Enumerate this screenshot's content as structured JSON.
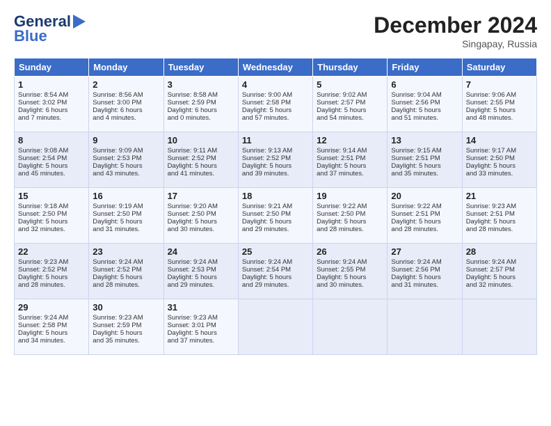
{
  "header": {
    "logo_line1": "General",
    "logo_line2": "Blue",
    "month": "December 2024",
    "location": "Singapay, Russia"
  },
  "days_of_week": [
    "Sunday",
    "Monday",
    "Tuesday",
    "Wednesday",
    "Thursday",
    "Friday",
    "Saturday"
  ],
  "weeks": [
    [
      {
        "day": 1,
        "lines": [
          "Sunrise: 8:54 AM",
          "Sunset: 3:02 PM",
          "Daylight: 6 hours",
          "and 7 minutes."
        ]
      },
      {
        "day": 2,
        "lines": [
          "Sunrise: 8:56 AM",
          "Sunset: 3:00 PM",
          "Daylight: 6 hours",
          "and 4 minutes."
        ]
      },
      {
        "day": 3,
        "lines": [
          "Sunrise: 8:58 AM",
          "Sunset: 2:59 PM",
          "Daylight: 6 hours",
          "and 0 minutes."
        ]
      },
      {
        "day": 4,
        "lines": [
          "Sunrise: 9:00 AM",
          "Sunset: 2:58 PM",
          "Daylight: 5 hours",
          "and 57 minutes."
        ]
      },
      {
        "day": 5,
        "lines": [
          "Sunrise: 9:02 AM",
          "Sunset: 2:57 PM",
          "Daylight: 5 hours",
          "and 54 minutes."
        ]
      },
      {
        "day": 6,
        "lines": [
          "Sunrise: 9:04 AM",
          "Sunset: 2:56 PM",
          "Daylight: 5 hours",
          "and 51 minutes."
        ]
      },
      {
        "day": 7,
        "lines": [
          "Sunrise: 9:06 AM",
          "Sunset: 2:55 PM",
          "Daylight: 5 hours",
          "and 48 minutes."
        ]
      }
    ],
    [
      {
        "day": 8,
        "lines": [
          "Sunrise: 9:08 AM",
          "Sunset: 2:54 PM",
          "Daylight: 5 hours",
          "and 45 minutes."
        ]
      },
      {
        "day": 9,
        "lines": [
          "Sunrise: 9:09 AM",
          "Sunset: 2:53 PM",
          "Daylight: 5 hours",
          "and 43 minutes."
        ]
      },
      {
        "day": 10,
        "lines": [
          "Sunrise: 9:11 AM",
          "Sunset: 2:52 PM",
          "Daylight: 5 hours",
          "and 41 minutes."
        ]
      },
      {
        "day": 11,
        "lines": [
          "Sunrise: 9:13 AM",
          "Sunset: 2:52 PM",
          "Daylight: 5 hours",
          "and 39 minutes."
        ]
      },
      {
        "day": 12,
        "lines": [
          "Sunrise: 9:14 AM",
          "Sunset: 2:51 PM",
          "Daylight: 5 hours",
          "and 37 minutes."
        ]
      },
      {
        "day": 13,
        "lines": [
          "Sunrise: 9:15 AM",
          "Sunset: 2:51 PM",
          "Daylight: 5 hours",
          "and 35 minutes."
        ]
      },
      {
        "day": 14,
        "lines": [
          "Sunrise: 9:17 AM",
          "Sunset: 2:50 PM",
          "Daylight: 5 hours",
          "and 33 minutes."
        ]
      }
    ],
    [
      {
        "day": 15,
        "lines": [
          "Sunrise: 9:18 AM",
          "Sunset: 2:50 PM",
          "Daylight: 5 hours",
          "and 32 minutes."
        ]
      },
      {
        "day": 16,
        "lines": [
          "Sunrise: 9:19 AM",
          "Sunset: 2:50 PM",
          "Daylight: 5 hours",
          "and 31 minutes."
        ]
      },
      {
        "day": 17,
        "lines": [
          "Sunrise: 9:20 AM",
          "Sunset: 2:50 PM",
          "Daylight: 5 hours",
          "and 30 minutes."
        ]
      },
      {
        "day": 18,
        "lines": [
          "Sunrise: 9:21 AM",
          "Sunset: 2:50 PM",
          "Daylight: 5 hours",
          "and 29 minutes."
        ]
      },
      {
        "day": 19,
        "lines": [
          "Sunrise: 9:22 AM",
          "Sunset: 2:50 PM",
          "Daylight: 5 hours",
          "and 28 minutes."
        ]
      },
      {
        "day": 20,
        "lines": [
          "Sunrise: 9:22 AM",
          "Sunset: 2:51 PM",
          "Daylight: 5 hours",
          "and 28 minutes."
        ]
      },
      {
        "day": 21,
        "lines": [
          "Sunrise: 9:23 AM",
          "Sunset: 2:51 PM",
          "Daylight: 5 hours",
          "and 28 minutes."
        ]
      }
    ],
    [
      {
        "day": 22,
        "lines": [
          "Sunrise: 9:23 AM",
          "Sunset: 2:52 PM",
          "Daylight: 5 hours",
          "and 28 minutes."
        ]
      },
      {
        "day": 23,
        "lines": [
          "Sunrise: 9:24 AM",
          "Sunset: 2:52 PM",
          "Daylight: 5 hours",
          "and 28 minutes."
        ]
      },
      {
        "day": 24,
        "lines": [
          "Sunrise: 9:24 AM",
          "Sunset: 2:53 PM",
          "Daylight: 5 hours",
          "and 29 minutes."
        ]
      },
      {
        "day": 25,
        "lines": [
          "Sunrise: 9:24 AM",
          "Sunset: 2:54 PM",
          "Daylight: 5 hours",
          "and 29 minutes."
        ]
      },
      {
        "day": 26,
        "lines": [
          "Sunrise: 9:24 AM",
          "Sunset: 2:55 PM",
          "Daylight: 5 hours",
          "and 30 minutes."
        ]
      },
      {
        "day": 27,
        "lines": [
          "Sunrise: 9:24 AM",
          "Sunset: 2:56 PM",
          "Daylight: 5 hours",
          "and 31 minutes."
        ]
      },
      {
        "day": 28,
        "lines": [
          "Sunrise: 9:24 AM",
          "Sunset: 2:57 PM",
          "Daylight: 5 hours",
          "and 32 minutes."
        ]
      }
    ],
    [
      {
        "day": 29,
        "lines": [
          "Sunrise: 9:24 AM",
          "Sunset: 2:58 PM",
          "Daylight: 5 hours",
          "and 34 minutes."
        ]
      },
      {
        "day": 30,
        "lines": [
          "Sunrise: 9:23 AM",
          "Sunset: 2:59 PM",
          "Daylight: 5 hours",
          "and 35 minutes."
        ]
      },
      {
        "day": 31,
        "lines": [
          "Sunrise: 9:23 AM",
          "Sunset: 3:01 PM",
          "Daylight: 5 hours",
          "and 37 minutes."
        ]
      },
      null,
      null,
      null,
      null
    ]
  ]
}
